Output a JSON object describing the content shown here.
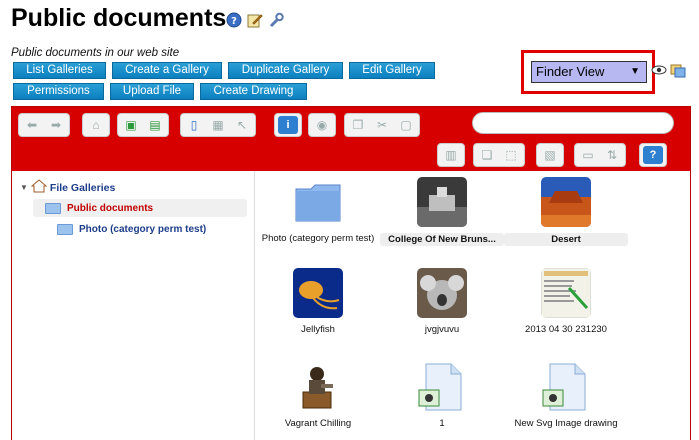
{
  "page": {
    "title": "Public documents",
    "description": "Public documents in our web site"
  },
  "title_icons": [
    "help-icon",
    "edit-icon",
    "wrench-icon"
  ],
  "buttons": {
    "list": "List Galleries",
    "create": "Create a Gallery",
    "duplicate": "Duplicate Gallery",
    "edit": "Edit Gallery",
    "permissions": "Permissions",
    "upload": "Upload File",
    "drawing": "Create Drawing"
  },
  "view": {
    "selected": "Finder View"
  },
  "colors": {
    "button": "#1a8fcf",
    "toolbar": "#d70000",
    "selection_border": "#e00000",
    "select_bg": "#b7b7f2"
  },
  "tree": {
    "root": "File Galleries",
    "items": [
      {
        "label": "Public documents",
        "selected": true
      },
      {
        "label": "Photo (category perm test)",
        "selected": false
      }
    ]
  },
  "files": [
    {
      "label": "Photo (category perm test)",
      "type": "folder"
    },
    {
      "label": "College Of New Bruns...",
      "type": "photo-bw"
    },
    {
      "label": "Desert",
      "type": "photo-desert"
    },
    {
      "label": "Jellyfish",
      "type": "photo-jellyfish"
    },
    {
      "label": "jvgjvuvu",
      "type": "photo-koala"
    },
    {
      "label": "2013 04 30 231230",
      "type": "screenshot"
    },
    {
      "label": "Vagrant Chilling",
      "type": "photo-vagrant"
    },
    {
      "label": "1",
      "type": "svg-doc"
    },
    {
      "label": "New Svg Image drawing",
      "type": "svg-doc"
    }
  ]
}
